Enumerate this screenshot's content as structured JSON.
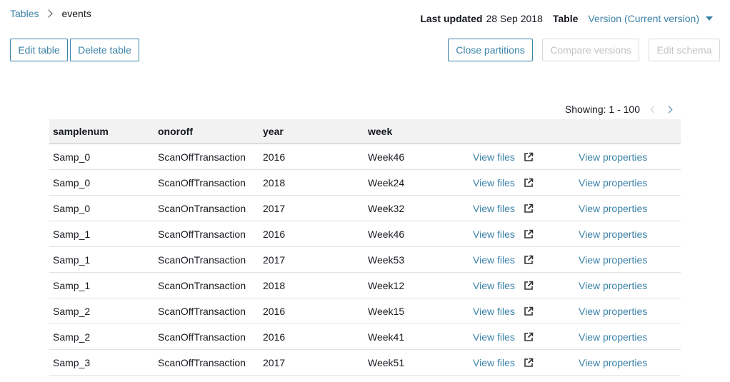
{
  "breadcrumb": {
    "parent": "Tables",
    "current": "events"
  },
  "meta": {
    "last_updated_label": "Last updated",
    "last_updated_value": "28 Sep 2018",
    "table_label": "Table",
    "version_select": "Version (Current version)"
  },
  "toolbar": {
    "edit_table": "Edit table",
    "delete_table": "Delete table",
    "close_partitions": "Close partitions",
    "compare_versions": "Compare versions",
    "edit_schema": "Edit schema"
  },
  "pagination": {
    "showing": "Showing: 1 - 100"
  },
  "table": {
    "columns": [
      "samplenum",
      "onoroff",
      "year",
      "week"
    ],
    "view_files_label": "View files",
    "view_properties_label": "View properties",
    "rows": [
      {
        "samplenum": "Samp_0",
        "onoroff": "ScanOffTransaction",
        "year": "2016",
        "week": "Week46"
      },
      {
        "samplenum": "Samp_0",
        "onoroff": "ScanOffTransaction",
        "year": "2018",
        "week": "Week24"
      },
      {
        "samplenum": "Samp_0",
        "onoroff": "ScanOnTransaction",
        "year": "2017",
        "week": "Week32"
      },
      {
        "samplenum": "Samp_1",
        "onoroff": "ScanOffTransaction",
        "year": "2016",
        "week": "Week46"
      },
      {
        "samplenum": "Samp_1",
        "onoroff": "ScanOnTransaction",
        "year": "2017",
        "week": "Week53"
      },
      {
        "samplenum": "Samp_1",
        "onoroff": "ScanOnTransaction",
        "year": "2018",
        "week": "Week12"
      },
      {
        "samplenum": "Samp_2",
        "onoroff": "ScanOffTransaction",
        "year": "2016",
        "week": "Week15"
      },
      {
        "samplenum": "Samp_2",
        "onoroff": "ScanOffTransaction",
        "year": "2016",
        "week": "Week41"
      },
      {
        "samplenum": "Samp_3",
        "onoroff": "ScanOffTransaction",
        "year": "2017",
        "week": "Week51"
      }
    ]
  },
  "colors": {
    "accent": "#3b82a8",
    "disabled": "#c3c3c3",
    "header_bg": "#f2f2f2"
  },
  "icons": {
    "breadcrumb_separator": "chevron-right-icon",
    "version_caret": "caret-down-icon",
    "prev_page": "chevron-left-icon",
    "next_page": "chevron-right-icon",
    "view_files": "external-link-icon"
  }
}
